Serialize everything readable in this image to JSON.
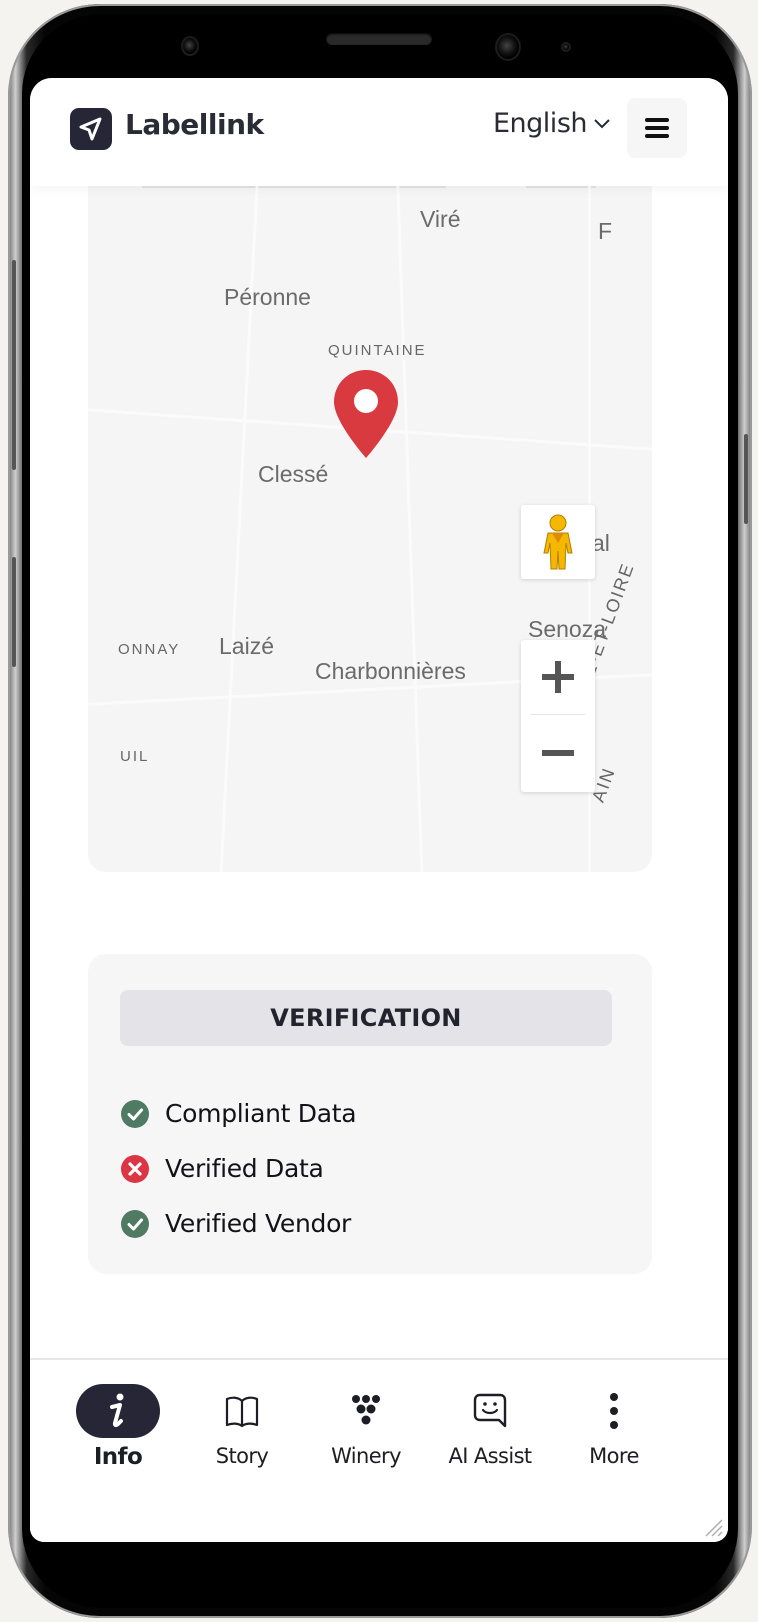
{
  "header": {
    "brand": "Labellink",
    "language": "English",
    "icons": {
      "logo": "paper-plane-icon",
      "language_dropdown": "chevron-down-icon",
      "menu": "hamburger-menu-icon"
    }
  },
  "map": {
    "places": [
      {
        "id": "vire",
        "label": "Viré"
      },
      {
        "id": "f",
        "label": "F"
      },
      {
        "id": "peronne",
        "label": "Péronne"
      },
      {
        "id": "quintaine",
        "label": "QUINTAINE"
      },
      {
        "id": "clesse",
        "label": "Clessé"
      },
      {
        "id": "al",
        "label": "al"
      },
      {
        "id": "senoza",
        "label": "Senoza"
      },
      {
        "id": "onnay",
        "label": "ONNAY"
      },
      {
        "id": "laize",
        "label": "Laizé"
      },
      {
        "id": "charbonnieres",
        "label": "Charbonnières"
      },
      {
        "id": "uil",
        "label": "UIL"
      },
      {
        "id": "saone_loire",
        "label": "SAÔNE-ET-LOIRE"
      },
      {
        "id": "ain",
        "label": "AIN"
      }
    ],
    "controls": {
      "zoom_in": "+",
      "zoom_out": "−",
      "icons": {
        "marker": "map-pin-icon",
        "street_view": "pegman-icon"
      }
    },
    "colors": {
      "pin": "#d93a3f",
      "pegman": "#f5b800"
    }
  },
  "verification": {
    "title": "VERIFICATION",
    "items": [
      {
        "label": "Compliant Data",
        "status": "pass",
        "icon": "check-circle-icon"
      },
      {
        "label": "Verified Data",
        "status": "fail",
        "icon": "x-circle-icon"
      },
      {
        "label": "Verified Vendor",
        "status": "pass",
        "icon": "check-circle-icon"
      }
    ],
    "colors": {
      "pass": "#4f7a63",
      "fail": "#dc3545"
    }
  },
  "bottom_nav": {
    "active": "Info",
    "items": [
      {
        "label": "Info",
        "icon": "info-icon"
      },
      {
        "label": "Story",
        "icon": "book-icon"
      },
      {
        "label": "Winery",
        "icon": "grapes-icon"
      },
      {
        "label": "AI Assist",
        "icon": "chat-smile-icon"
      },
      {
        "label": "More",
        "icon": "more-vertical-icon"
      }
    ]
  },
  "colors": {
    "brand_dark": "#262637",
    "text": "#1d1d25"
  }
}
